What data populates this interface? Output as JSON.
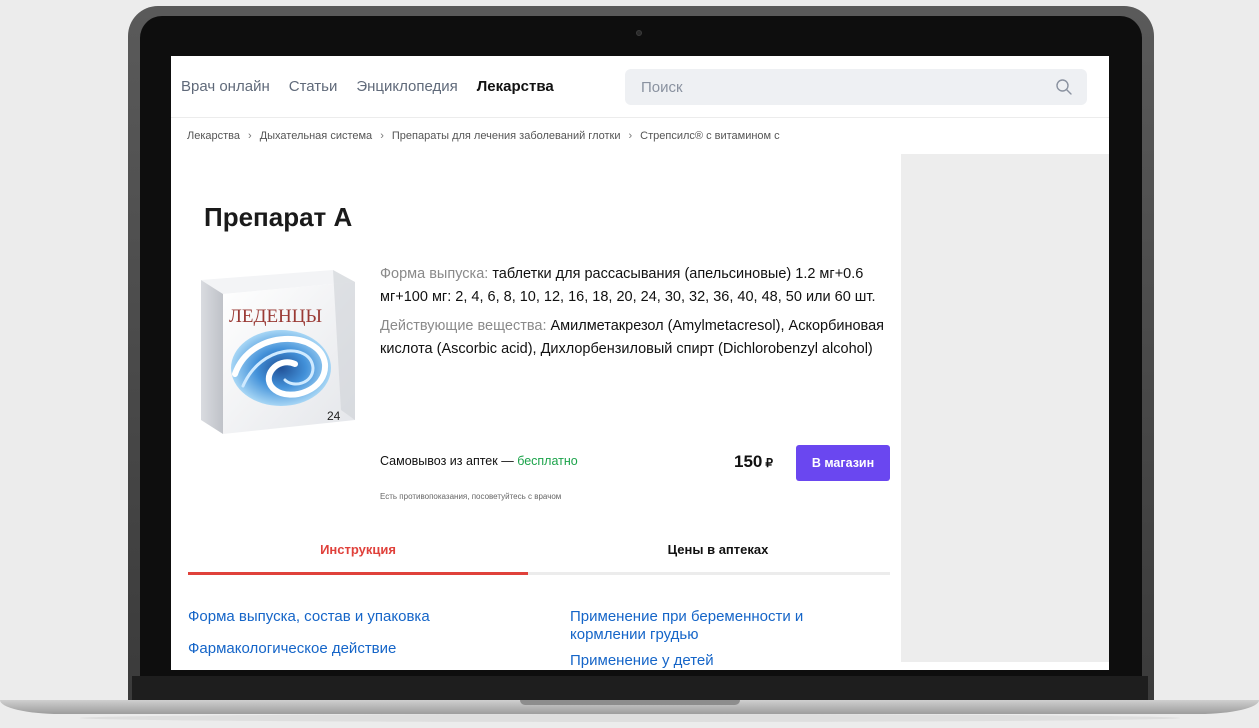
{
  "nav": {
    "items": [
      "Врач онлайн",
      "Статьи",
      "Энциклопедия"
    ],
    "active": "Лекарства"
  },
  "search": {
    "placeholder": "Поиск"
  },
  "breadcrumb": [
    "Лекарства",
    "Дыхательная система",
    "Препараты для лечения заболеваний глотки",
    "Стрепсилс® с витамином с"
  ],
  "product": {
    "title": "Препарат А",
    "box_label": "ЛЕДЕНЦЫ",
    "box_count": "24",
    "form_label": "Форма выпуска:",
    "form_value": "таблетки для рассасывания (апельсиновые) 1.2 мг+0.6 мг+100 мг: 2, 4, 6, 8, 10, 12, 16, 18, 20, 24, 30, 32, 36, 40, 48, 50 или 60 шт.",
    "substances_label": "Действующие вещества:",
    "substances_value": "Амилметакрезол (Amylmetacresol), Аскорбиновая кислота (Ascorbic acid), Дихлорбензиловый спирт (Dichlorobenzyl alcohol)",
    "pickup_text": "Самовывоз из аптек —",
    "pickup_free": "бесплатно",
    "price": "150",
    "currency": "₽",
    "buy_label": "В магазин",
    "warning": "Есть противопоказания, посоветуйтесь с врачом"
  },
  "tabs": {
    "instruction": "Инструкция",
    "prices": "Цены в аптеках"
  },
  "links": {
    "left": [
      "Форма выпуска, состав и упаковка",
      "Фармакологическое действие"
    ],
    "right": [
      "Применение при беременности и кормлении грудью",
      "Применение у детей"
    ]
  },
  "colors": {
    "accent_red": "#e0413b",
    "button_purple": "#6a47f0",
    "link_blue": "#1565c8",
    "free_green": "#1ba34a"
  }
}
